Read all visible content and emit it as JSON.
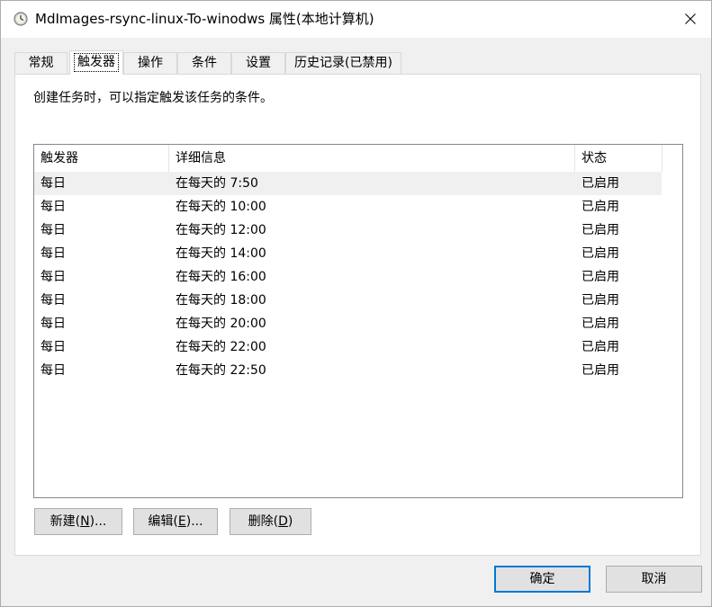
{
  "window": {
    "title": "MdImages-rsync-linux-To-winodws 属性(本地计算机)",
    "icon": "clock-icon",
    "close_icon": "close-icon"
  },
  "tabs": [
    {
      "label": "常规",
      "active": false
    },
    {
      "label": "触发器",
      "active": true
    },
    {
      "label": "操作",
      "active": false
    },
    {
      "label": "条件",
      "active": false
    },
    {
      "label": "设置",
      "active": false
    },
    {
      "label": "历史记录(已禁用)",
      "active": false
    }
  ],
  "triggers_panel": {
    "description": "创建任务时，可以指定触发该任务的条件。",
    "columns": [
      "触发器",
      "详细信息",
      "状态"
    ],
    "rows": [
      {
        "trigger": "每日",
        "details": "在每天的 7:50",
        "status": "已启用",
        "selected": true
      },
      {
        "trigger": "每日",
        "details": "在每天的 10:00",
        "status": "已启用"
      },
      {
        "trigger": "每日",
        "details": "在每天的 12:00",
        "status": "已启用"
      },
      {
        "trigger": "每日",
        "details": "在每天的 14:00",
        "status": "已启用"
      },
      {
        "trigger": "每日",
        "details": "在每天的 16:00",
        "status": "已启用"
      },
      {
        "trigger": "每日",
        "details": "在每天的 18:00",
        "status": "已启用"
      },
      {
        "trigger": "每日",
        "details": "在每天的 20:00",
        "status": "已启用"
      },
      {
        "trigger": "每日",
        "details": "在每天的 22:00",
        "status": "已启用"
      },
      {
        "trigger": "每日",
        "details": "在每天的 22:50",
        "status": "已启用"
      }
    ],
    "buttons": {
      "new": {
        "label": "新建(",
        "mnemonic": "N",
        "suffix": ")..."
      },
      "edit": {
        "label": "编辑(",
        "mnemonic": "E",
        "suffix": ")..."
      },
      "delete": {
        "label": "删除(",
        "mnemonic": "D",
        "suffix": ")"
      }
    }
  },
  "dialog_buttons": {
    "ok": "确定",
    "cancel": "取消"
  },
  "colors": {
    "window_bg": "#f0f0f0",
    "panel_bg": "#ffffff",
    "selected_row_bg": "#f0f0f0",
    "default_button_border": "#0078d7"
  }
}
